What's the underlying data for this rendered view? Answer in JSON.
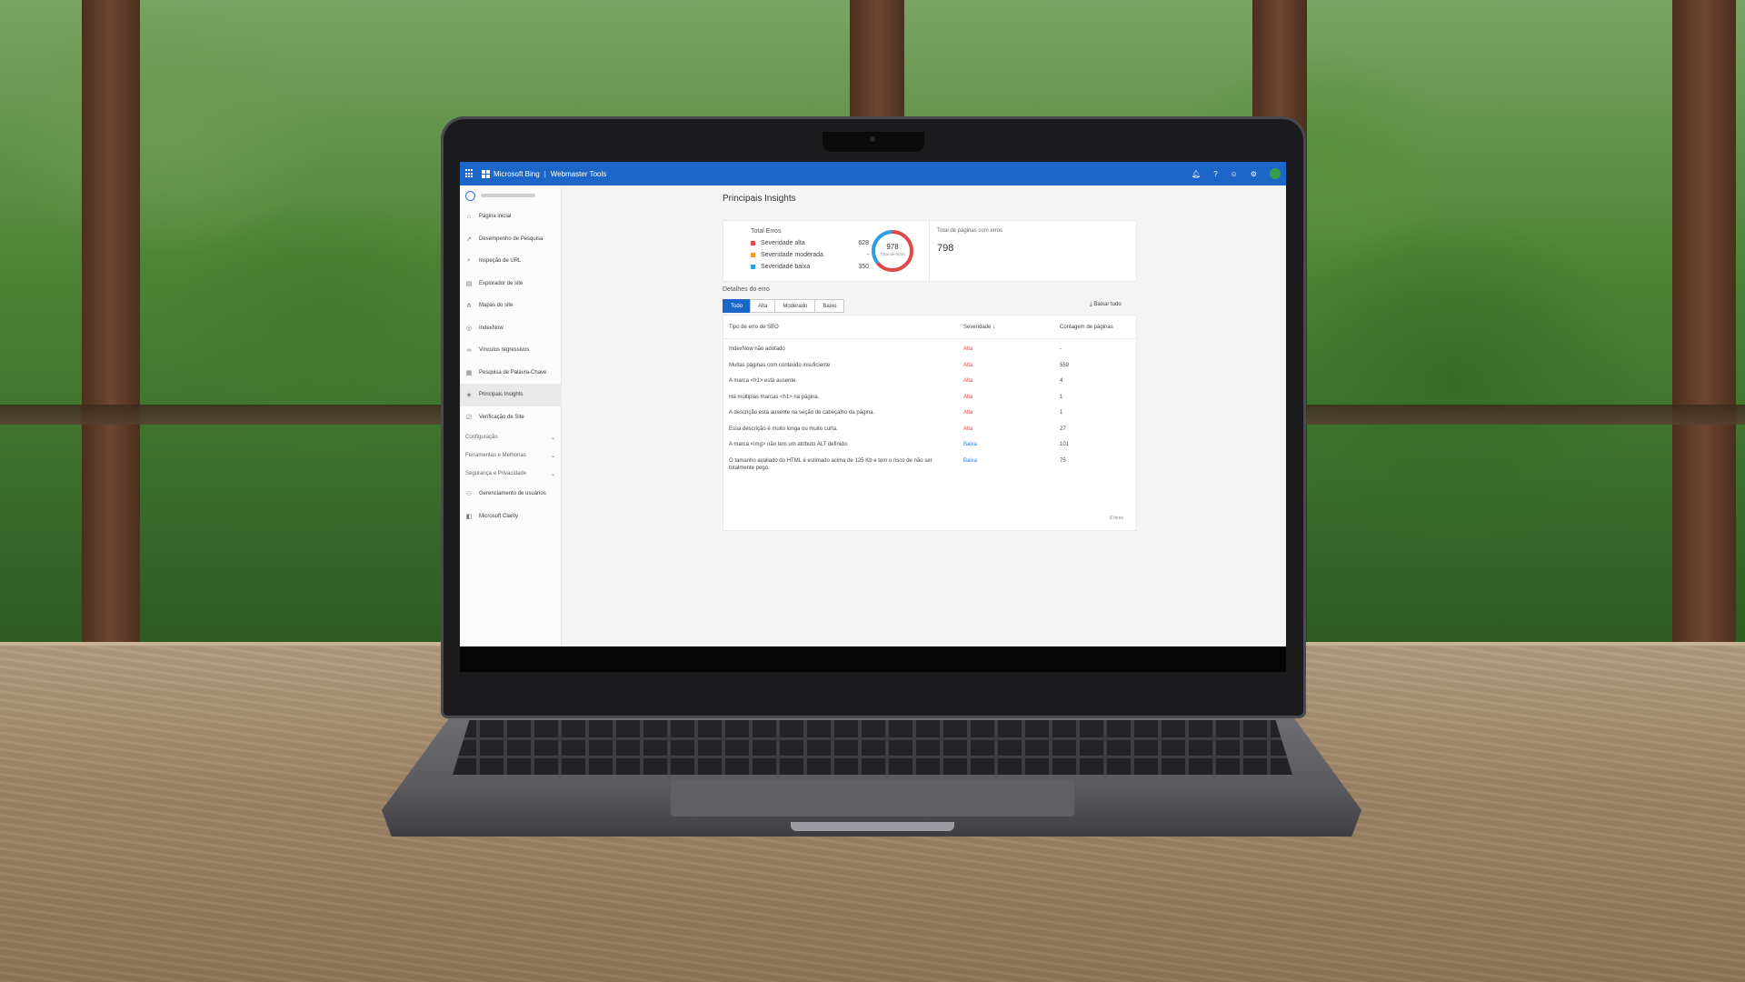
{
  "app": {
    "brand": "Microsoft Bing",
    "product": "Webmaster Tools",
    "header_icons": [
      "bell-icon",
      "help-icon",
      "feedback-icon",
      "settings-icon",
      "avatar"
    ]
  },
  "sidebar": {
    "items": [
      {
        "label": "Página inicial",
        "icon": "home-icon",
        "glyph": "⌂"
      },
      {
        "label": "Desempenho de Pesquisa",
        "icon": "trend-icon",
        "glyph": "↗"
      },
      {
        "label": "Inspeção de URL",
        "icon": "search-icon",
        "glyph": "⌕"
      },
      {
        "label": "Explorador de site",
        "icon": "folder-icon",
        "glyph": "▤"
      },
      {
        "label": "Mapas do site",
        "icon": "sitemap-icon",
        "glyph": "⋔"
      },
      {
        "label": "IndexNow",
        "icon": "indexnow-icon",
        "glyph": "◎"
      },
      {
        "label": "Vínculos regressivos",
        "icon": "link-icon",
        "glyph": "∞"
      },
      {
        "label": "Pesquisa de Palavra-Chave",
        "icon": "keyword-icon",
        "glyph": "▦"
      },
      {
        "label": "Principais Insights",
        "icon": "insights-icon",
        "glyph": "◈",
        "active": true
      },
      {
        "label": "Verificação de Site",
        "icon": "check-icon",
        "glyph": "☑"
      }
    ],
    "sections": [
      {
        "label": "Configuração"
      },
      {
        "label": "Ferramentas e Melhorias"
      },
      {
        "label": "Segurança e Privacidade"
      }
    ],
    "bottom_items": [
      {
        "label": "Gerenciamento de usuários",
        "icon": "users-icon",
        "glyph": "⚇"
      },
      {
        "label": "Microsoft Clarity",
        "icon": "clarity-icon",
        "glyph": "◧"
      }
    ]
  },
  "main": {
    "title": "Principais Insights",
    "errors_card": {
      "title": "Total Erros",
      "rows": [
        {
          "label": "Severidade alta",
          "count": "628",
          "color": "#e04848"
        },
        {
          "label": "Severidade moderada",
          "count": "-",
          "color": "#f0a020"
        },
        {
          "label": "Severidade baixa",
          "count": "350",
          "color": "#2d9fe0"
        }
      ],
      "total": "978",
      "total_label": "Total de erros",
      "donut": {
        "high_fraction": 0.642,
        "low_fraction": 0.358
      }
    },
    "pages_card": {
      "title": "Total de páginas com erros",
      "value": "798"
    },
    "details_title": "Detalhes do erro",
    "tabs": [
      {
        "label": "Todo",
        "active": true
      },
      {
        "label": "Alta",
        "active": false
      },
      {
        "label": "Moderado",
        "active": false
      },
      {
        "label": "Baixo",
        "active": false
      }
    ],
    "download_label": "Baixar tudo",
    "table": {
      "headers": [
        "Tipo de erro de SEO",
        "Severidade ↓",
        "Contagem de páginas"
      ],
      "rows": [
        {
          "type": "IndexNow não adotado",
          "severity": "Alta",
          "level": "alta",
          "count": "-"
        },
        {
          "type": "Muitas páginas com conteúdo insuficiente",
          "severity": "Alta",
          "level": "alta",
          "count": "559"
        },
        {
          "type": "A marca <h1> está ausente.",
          "severity": "Alta",
          "level": "alta",
          "count": "4"
        },
        {
          "type": "Há múltiplas marcas <h1> na página.",
          "severity": "Alta",
          "level": "alta",
          "count": "1"
        },
        {
          "type": "A descrição está ausente na seção de cabeçalho da página.",
          "severity": "Alta",
          "level": "alta",
          "count": "1"
        },
        {
          "type": "Essa descrição é muito longa ou muito curta.",
          "severity": "Alta",
          "level": "alta",
          "count": "27"
        },
        {
          "type": "A marca <img> não tem um atributo ALT definido.",
          "severity": "Baixa",
          "level": "baixa",
          "count": "101"
        },
        {
          "type": "O tamanho avaliado do HTML é estimado acima de 125 Kb e tem o risco de não ser totalmente pego.",
          "severity": "Baixa",
          "level": "baixa",
          "count": "75"
        }
      ],
      "footer": "8 Itens"
    }
  }
}
